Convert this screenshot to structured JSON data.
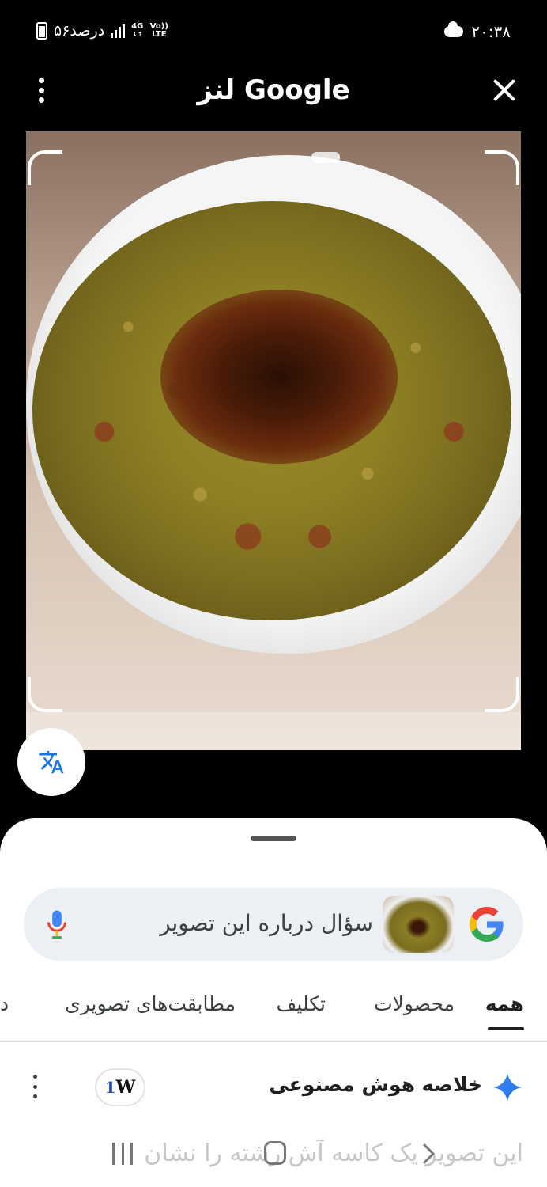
{
  "status_bar": {
    "time": "۲۰:۳۸",
    "battery_text": "۵۶درصد",
    "network_type": "4G",
    "volte": "Vo)) LTE",
    "weather_icon": "cloud-icon",
    "battery_icon": "battery-icon",
    "signal_icon": "signal-icon"
  },
  "header": {
    "title": "Google لنز",
    "menu_icon": "more-vert-icon",
    "close_icon": "close-icon"
  },
  "image": {
    "description_icon": "food-photo",
    "translate_icon": "translate-icon"
  },
  "search": {
    "placeholder": "سؤال درباره این تصویر",
    "mic_icon": "mic-icon",
    "google_icon": "google-g-icon"
  },
  "tabs": [
    {
      "label": "همه",
      "active": true
    },
    {
      "label": "محصولات",
      "active": false
    },
    {
      "label": "تکلیف",
      "active": false
    },
    {
      "label": "مطابقت‌های تصویری",
      "active": false
    },
    {
      "label": "د",
      "active": false
    }
  ],
  "ai_overview": {
    "title": "خلاصه هوش مصنوعی",
    "source_logo_text": "W",
    "sparkle_icon": "sparkle-icon",
    "summary_preview": "این تصویر یک کاسه آش رشته را نشان"
  },
  "nav_bar": {
    "recent_icon": "recent-apps-icon",
    "home_icon": "home-icon",
    "back_icon": "back-icon"
  },
  "colors": {
    "google_blue": "#4285F4",
    "google_red": "#EA4335",
    "google_yellow": "#FBBC05",
    "google_green": "#34A853"
  }
}
